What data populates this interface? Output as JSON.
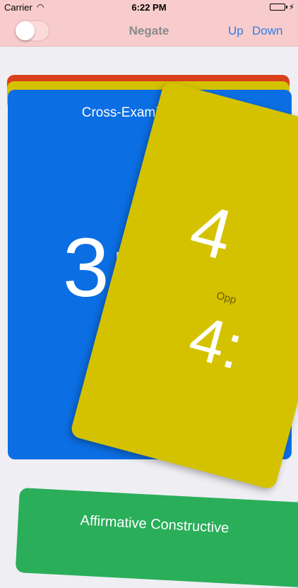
{
  "status_bar": {
    "carrier": "Carrier",
    "time": "6:22 PM"
  },
  "nav_bar": {
    "title": "Negate",
    "up_label": "Up",
    "down_label": "Down",
    "toggle_on": false
  },
  "cards": {
    "blue": {
      "title": "Cross-Examination",
      "timer": "3:0"
    },
    "yellow": {
      "big_number": "4",
      "label": "Opp",
      "timer": "4:"
    },
    "green": {
      "title": "Affirmative Constructive"
    }
  },
  "colors": {
    "nav_background": "#f8cccc",
    "accent_blue": "#2f7de6",
    "card_red": "#d9401a",
    "card_yellow": "#d4c200",
    "card_blue": "#0b6ee3",
    "card_green": "#2aae5a"
  }
}
